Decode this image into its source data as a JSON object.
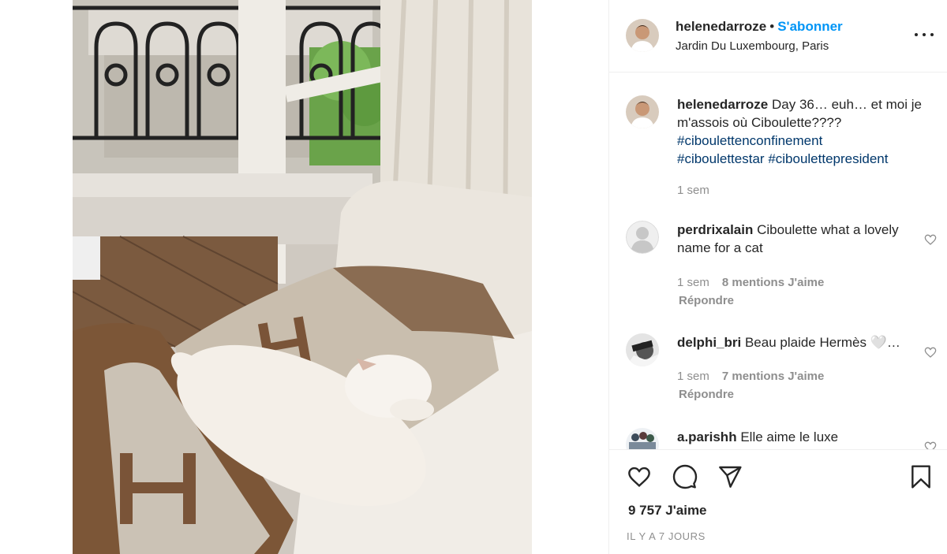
{
  "post": {
    "username": "helenedarroze",
    "separator": "•",
    "follow_label": "S'abonner",
    "location": "Jardin Du Luxembourg, Paris"
  },
  "caption": {
    "username": "helenedarroze",
    "text": "Day 36… euh… et moi je m'assois où Ciboulette????",
    "hashtags": [
      "#ciboulettenconfinement",
      "#ciboulettestar",
      "#ciboulettepresident"
    ],
    "time": "1 sem"
  },
  "comments": [
    {
      "username": "perdrixalain",
      "text": "Ciboulette what a lovely name for a cat",
      "time": "1 sem",
      "likes": "8 mentions J'aime",
      "reply_label": "Répondre"
    },
    {
      "username": "delphi_bri",
      "text": "Beau plaide Hermès 🤍…",
      "time": "1 sem",
      "likes": "7 mentions J'aime",
      "reply_label": "Répondre"
    },
    {
      "username": "a.parishh",
      "text": "Elle aime le luxe"
    }
  ],
  "footer": {
    "likes": "9 757 J'aime",
    "date": "IL Y A 7 JOURS"
  },
  "icons": {
    "more": "more-options-icon",
    "like": "heart-icon",
    "comment": "comment-icon",
    "share": "send-icon",
    "save": "bookmark-icon"
  },
  "colors": {
    "follow": "#0095f6",
    "hashtag": "#00376b",
    "secondary": "#8e8e8e",
    "primary_text": "#262626"
  }
}
